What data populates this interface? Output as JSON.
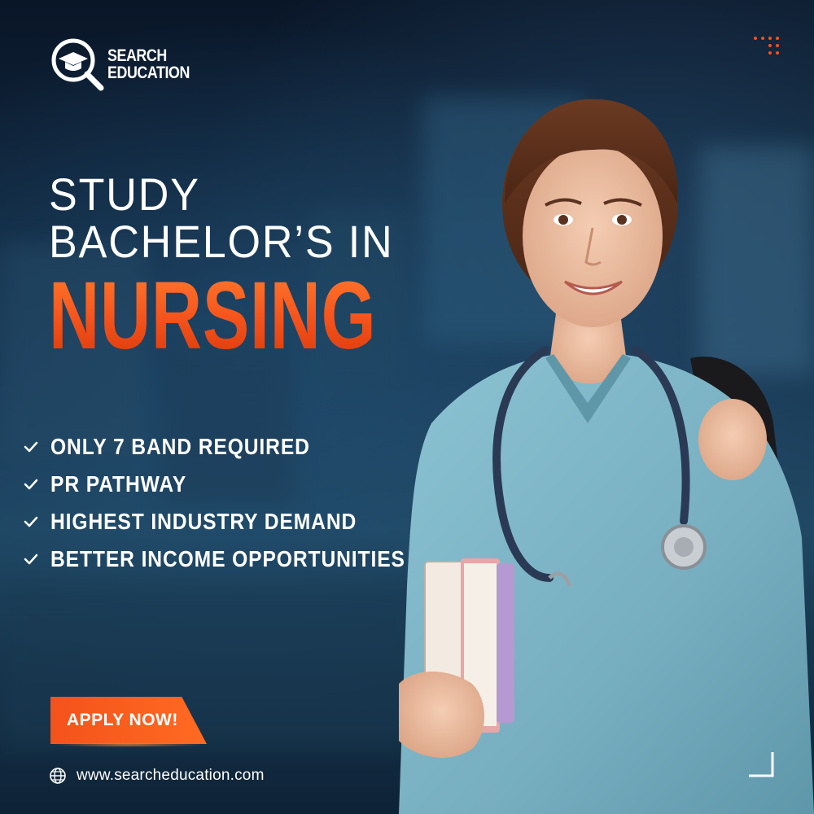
{
  "brand": {
    "line1": "SEARCH",
    "line2": "EDUCATION"
  },
  "headline": {
    "line1": "STUDY",
    "line2": "BACHELOR’S IN",
    "line3": "NURSING"
  },
  "benefits": [
    "ONLY 7 BAND REQUIRED",
    "PR PATHWAY",
    "HIGHEST INDUSTRY DEMAND",
    "BETTER INCOME OPPORTUNITIES"
  ],
  "cta": {
    "label": "APPLY NOW!"
  },
  "website": {
    "url": "www.searcheducation.com"
  },
  "icons": {
    "logo": "magnifier-graduation-cap-icon",
    "check": "check-icon",
    "globe": "globe-icon",
    "dots": "dot-grid-icon",
    "corner": "corner-bracket-icon"
  },
  "colors": {
    "accent": "#f4521b",
    "accent_light": "#ff7a2e",
    "text": "#ffffff",
    "background": "#0b1a2c",
    "scrubs": "#7fb8c9"
  }
}
